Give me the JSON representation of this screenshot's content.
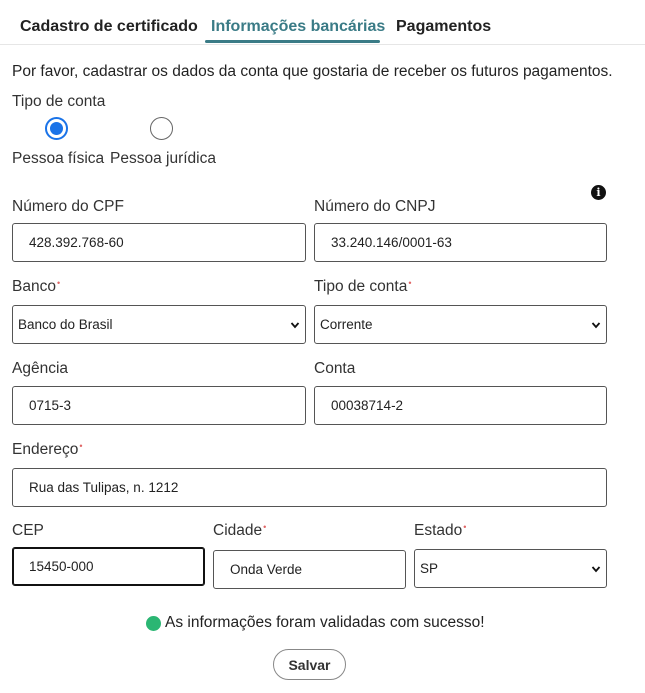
{
  "tabs": [
    {
      "label": "Cadastro de certificado",
      "active": false
    },
    {
      "label": "Informações bancárias",
      "active": true
    },
    {
      "label": "Pagamentos",
      "active": false
    }
  ],
  "intro": "Por favor, cadastrar os dados da conta que gostaria de receber os futuros pagamentos.",
  "account_type": {
    "label": "Tipo de conta",
    "options": [
      {
        "label": "Pessoa física",
        "checked": true
      },
      {
        "label": "Pessoa jurídica",
        "checked": false
      }
    ]
  },
  "info_icon_glyph": "i",
  "fields": {
    "cpf": {
      "label": "Número do CPF",
      "value": "428.392.768-60"
    },
    "cnpj": {
      "label": "Número do CNPJ",
      "value": "33.240.146/0001-63"
    },
    "banco": {
      "label": "Banco",
      "value": "Banco do Brasil",
      "required": true
    },
    "tipo_conta": {
      "label": "Tipo de conta",
      "value": "Corrente",
      "required": true
    },
    "agencia": {
      "label": "Agência",
      "value": "0715-3"
    },
    "conta": {
      "label": "Conta",
      "value": "00038714-2"
    },
    "endereco": {
      "label": "Endereço",
      "value": "Rua das Tulipas, n. 1212",
      "required": true
    },
    "cep": {
      "label": "CEP",
      "value": "15450-000"
    },
    "cidade": {
      "label": "Cidade",
      "value": "Onda Verde",
      "required": true
    },
    "estado": {
      "label": "Estado",
      "value": "SP",
      "required": true
    }
  },
  "required_mark": "•",
  "status": {
    "message": "As informações foram validadas com sucesso!",
    "color": "#2bb673"
  },
  "save_label": "Salvar",
  "colors": {
    "accent": "#3a7b86",
    "radio": "#1a73e8",
    "required": "#e06666"
  }
}
